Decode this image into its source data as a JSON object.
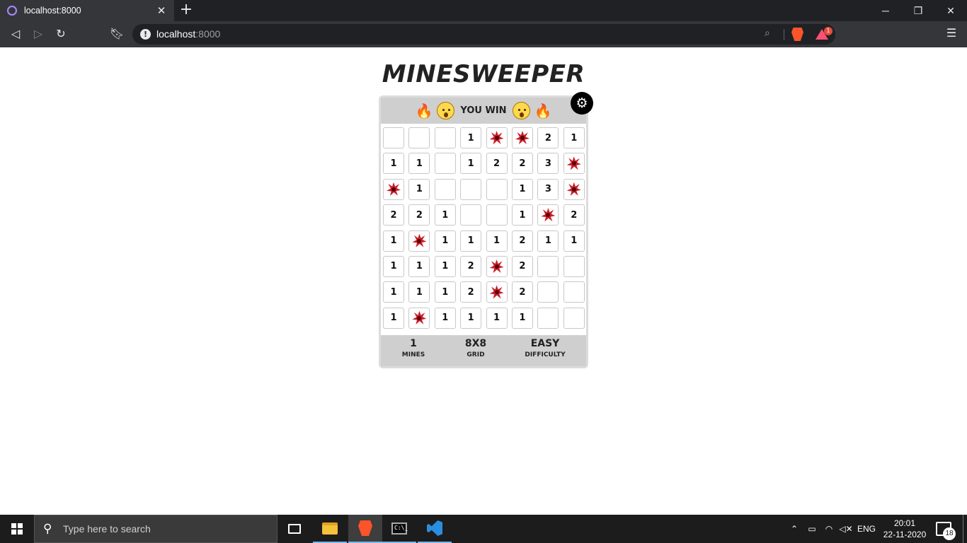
{
  "browser": {
    "tab_title": "localhost:8000",
    "tab_close": "✕",
    "new_tab": "+",
    "url_host": "localhost",
    "url_port": ":8000",
    "rewards_count": "1",
    "window_controls": {
      "minimize": "─",
      "restore": "❐",
      "close": "✕"
    }
  },
  "game": {
    "title": "MINESWEEPER",
    "status_text": "YOU WIN",
    "status_emojis": [
      "🔥",
      "😲",
      "😲",
      "🔥"
    ],
    "settings_icon": "⚙",
    "grid": [
      [
        "",
        "",
        "",
        "1",
        "M",
        "M",
        "2",
        "1"
      ],
      [
        "1",
        "1",
        "",
        "1",
        "2",
        "2",
        "3",
        "M"
      ],
      [
        "M",
        "1",
        "",
        "",
        "",
        "1",
        "3",
        "M"
      ],
      [
        "2",
        "2",
        "1",
        "",
        "",
        "1",
        "M",
        "2"
      ],
      [
        "1",
        "M",
        "1",
        "1",
        "1",
        "2",
        "1",
        "1"
      ],
      [
        "1",
        "1",
        "1",
        "2",
        "M",
        "2",
        "",
        ""
      ],
      [
        "1",
        "1",
        "1",
        "2",
        "M",
        "2",
        "",
        ""
      ],
      [
        "1",
        "M",
        "1",
        "1",
        "1",
        "1",
        "",
        ""
      ]
    ],
    "stats": [
      {
        "value": "1",
        "label": "MINES"
      },
      {
        "value": "8X8",
        "label": "GRID"
      },
      {
        "value": "EASY",
        "label": "DIFFICULTY"
      }
    ]
  },
  "taskbar": {
    "search_placeholder": "Type here to search",
    "language": "ENG",
    "time": "20:01",
    "date": "22-11-2020",
    "notification_count": "18"
  }
}
